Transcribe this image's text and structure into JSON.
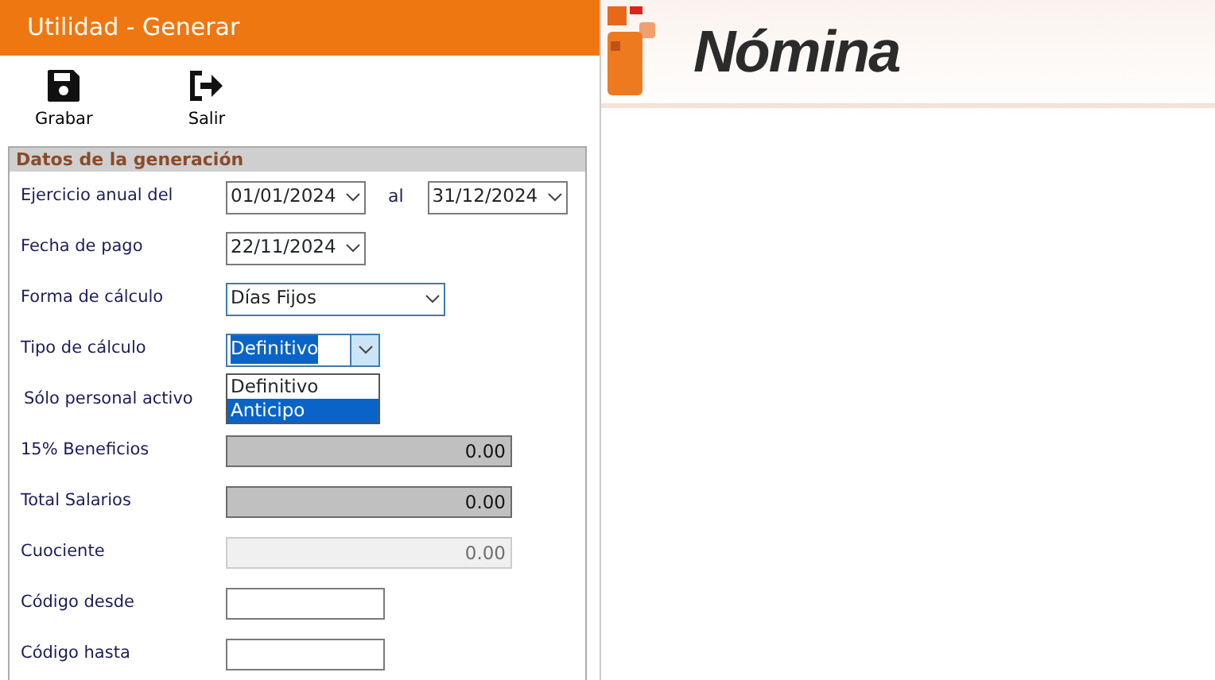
{
  "window": {
    "title": "Utilidad - Generar"
  },
  "toolbar": [
    {
      "kind": "save",
      "label": "Grabar"
    },
    {
      "kind": "exit",
      "label": "Salir"
    }
  ],
  "group": {
    "title": "Datos de la generación",
    "fields": [
      {
        "kind": "daterange",
        "label": "Ejercicio anual del",
        "value": "01/01/2024",
        "separator": "al",
        "value_to": "31/12/2024"
      },
      {
        "kind": "date",
        "label": "Fecha de pago",
        "value": "22/11/2024"
      },
      {
        "kind": "combo",
        "label": "Forma de cálculo",
        "value": "Días Fijos",
        "focused": false
      },
      {
        "kind": "combo",
        "label": "Tipo de cálculo",
        "value": "Definitivo",
        "focused": true
      },
      {
        "kind": "label",
        "label": "Sólo personal activo"
      },
      {
        "kind": "amount",
        "label": "15% Beneficios",
        "value": "0.00",
        "disabled": false
      },
      {
        "kind": "amount",
        "label": "Total Salarios",
        "value": "0.00",
        "disabled": false
      },
      {
        "kind": "amount",
        "label": "Cuociente",
        "value": "0.00",
        "disabled": true
      },
      {
        "kind": "text",
        "label": "Código desde"
      },
      {
        "kind": "text",
        "label": "Código hasta"
      }
    ]
  },
  "dropdown": {
    "items": [
      {
        "label": "Definitivo",
        "selected": false
      },
      {
        "label": "Anticipo",
        "selected": true
      }
    ]
  },
  "logo": {
    "text": "Nómina"
  }
}
